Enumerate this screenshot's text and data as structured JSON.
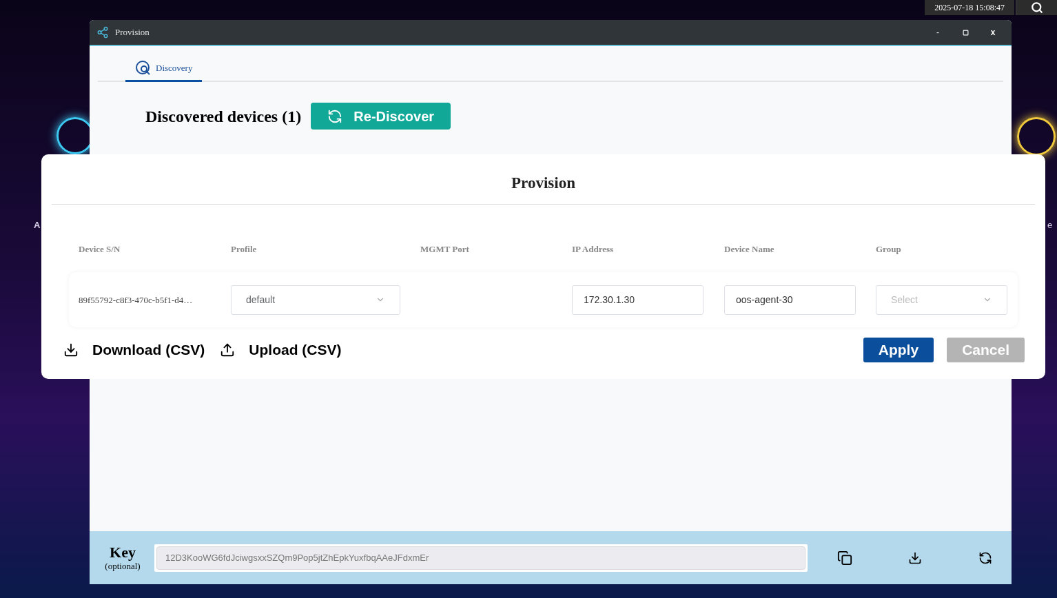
{
  "desktop": {
    "clock": "2025-07-18 15:08:47",
    "left_label": "A",
    "right_label": "e"
  },
  "window": {
    "title": "Provision",
    "controls": {
      "minimize": "-",
      "close": "x"
    }
  },
  "tabs": [
    {
      "label": "Discovery",
      "selected": true
    }
  ],
  "discovered": {
    "heading": "Discovered devices (1)",
    "button": "Re-Discover"
  },
  "dialog": {
    "title": "Provision",
    "columns": [
      "Device S/N",
      "Profile",
      "MGMT Port",
      "IP Address",
      "Device Name",
      "Group"
    ],
    "rows": [
      {
        "serial": "89f55792-c8f3-470c-b5f1-d4…",
        "profile": "default",
        "ip_address": "172.30.1.30",
        "device_name": "oos-agent-30",
        "group": {
          "placeholder": "Select"
        }
      }
    ],
    "links": [
      "Download (CSV)",
      "Upload (CSV)"
    ],
    "buttons": [
      {
        "label": "Apply",
        "disabled": false
      },
      {
        "label": "Cancel",
        "disabled": true
      }
    ]
  },
  "key_bar": {
    "label": "Key",
    "sublabel": "(optional)",
    "value": "12D3KooWG6fdJciwgsxxSZQm9Pop5jtZhEpkYuxfbqAAeJFdxmEr"
  }
}
